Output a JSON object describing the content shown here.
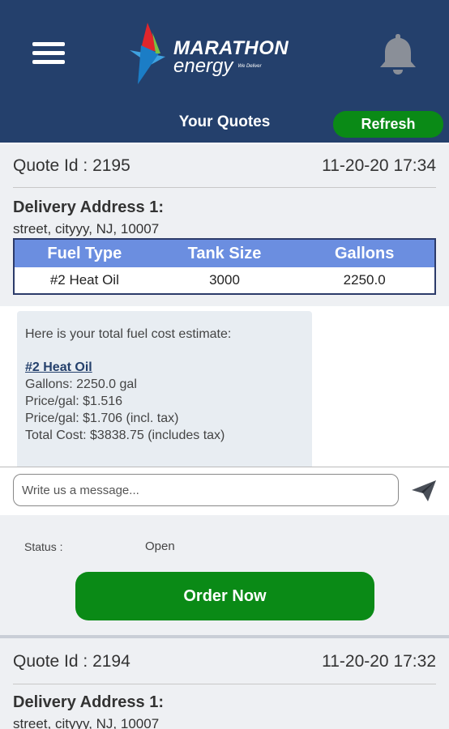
{
  "header": {
    "brand_name": "MARATHON",
    "brand_sub": "energy",
    "brand_tagline": "We Deliver",
    "page_title": "Your Quotes",
    "refresh_label": "Refresh",
    "menu_icon": "hamburger-menu-icon",
    "bell_icon": "bell-icon"
  },
  "quotes": [
    {
      "id_label": "Quote Id :",
      "id": "2195",
      "datetime": "11-20-20 17:34",
      "address_label": "Delivery Address 1:",
      "address": "street, cityyy, NJ, 10007",
      "table": {
        "headers": [
          "Fuel Type",
          "Tank Size",
          "Gallons"
        ],
        "rows": [
          [
            "#2 Heat Oil",
            "3000",
            "2250.0"
          ]
        ]
      },
      "message": {
        "intro": "Here is your total fuel cost estimate:",
        "fuel_name": "#2 Heat Oil",
        "lines": [
          "Gallons: 2250.0 gal",
          "Price/gal: $1.516",
          "Price/gal: $1.706 (incl. tax)",
          "Total Cost: $3838.75 (includes tax)"
        ]
      },
      "composer": {
        "placeholder": "Write us a message...",
        "send_icon": "send-icon"
      },
      "status_label": "Status :",
      "status_value": "Open",
      "order_label": "Order Now"
    },
    {
      "id_label": "Quote Id :",
      "id": "2194",
      "datetime": "11-20-20 17:32",
      "address_label": "Delivery Address 1:",
      "address": "street, cityyy, NJ, 10007"
    }
  ],
  "colors": {
    "header_bg": "#24406c",
    "accent_green": "#0a8a16",
    "table_header": "#6b8ee0",
    "card_bg": "#eef0f3"
  }
}
